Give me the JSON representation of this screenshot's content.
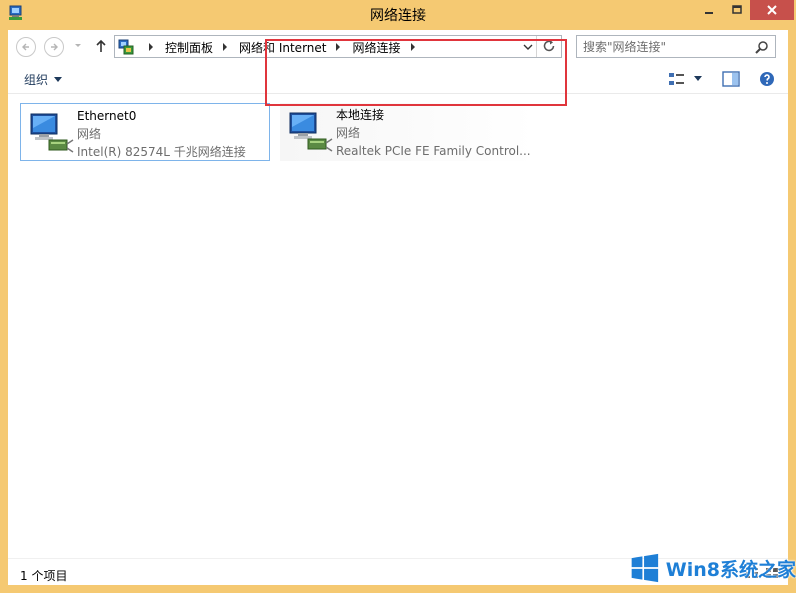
{
  "window": {
    "title": "网络连接"
  },
  "address_bar": {
    "breadcrumbs": [
      "控制面板",
      "网络和 Internet",
      "网络连接"
    ]
  },
  "search": {
    "placeholder": "搜索\"网络连接\""
  },
  "toolbar": {
    "organize_label": "组织"
  },
  "connections": [
    {
      "name": "Ethernet0",
      "status": "网络",
      "adapter": "Intel(R) 82574L 千兆网络连接"
    },
    {
      "name": "本地连接",
      "status": "网络",
      "adapter": "Realtek PCIe FE Family Control..."
    }
  ],
  "status_bar": {
    "text": "1 个项目"
  },
  "watermark": {
    "text": "Win8系统之家"
  },
  "colors": {
    "title_bar": "#f5c972",
    "close_button": "#c7504b",
    "selection_border": "#7eb4ea",
    "highlight_box": "#e0353c",
    "watermark_blue": "#1e7fd6"
  }
}
